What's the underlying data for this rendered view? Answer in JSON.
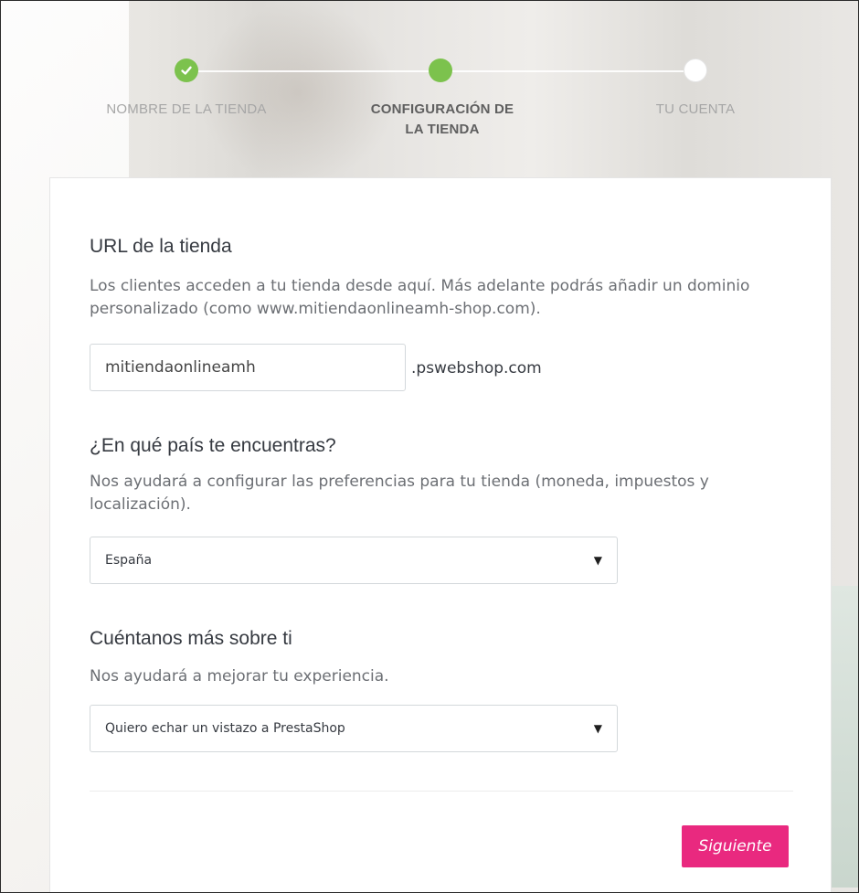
{
  "stepper": {
    "steps": [
      {
        "label": "NOMBRE DE LA TIENDA",
        "state": "completed"
      },
      {
        "label": "CONFIGURACIÓN DE LA TIENDA",
        "state": "active"
      },
      {
        "label": "TU CUENTA",
        "state": "pending"
      }
    ],
    "icons": {
      "completed": "check-icon"
    }
  },
  "form": {
    "url_section": {
      "title": "URL de la tienda",
      "description": "Los clientes acceden a tu tienda desde aquí. Más adelante podrás añadir un dominio personalizado (como www.mitiendaonlineamh-shop.com).",
      "input_value": "mitiendaonlineamh",
      "suffix": ".pswebshop.com"
    },
    "country_section": {
      "title": "¿En qué país te encuentras?",
      "description": "Nos ayudará a configurar las preferencias para tu tienda (moneda, impuestos y localización).",
      "selected": "España"
    },
    "about_section": {
      "title": "Cuéntanos más sobre ti",
      "description": "Nos ayudará a mejorar tu experiencia.",
      "selected": "Quiero echar un vistazo a PrestaShop"
    },
    "next_label": "Siguiente",
    "caret_icon": "▼"
  },
  "colors": {
    "accent_green": "#7cc24d",
    "button_pink": "#e9297f"
  }
}
